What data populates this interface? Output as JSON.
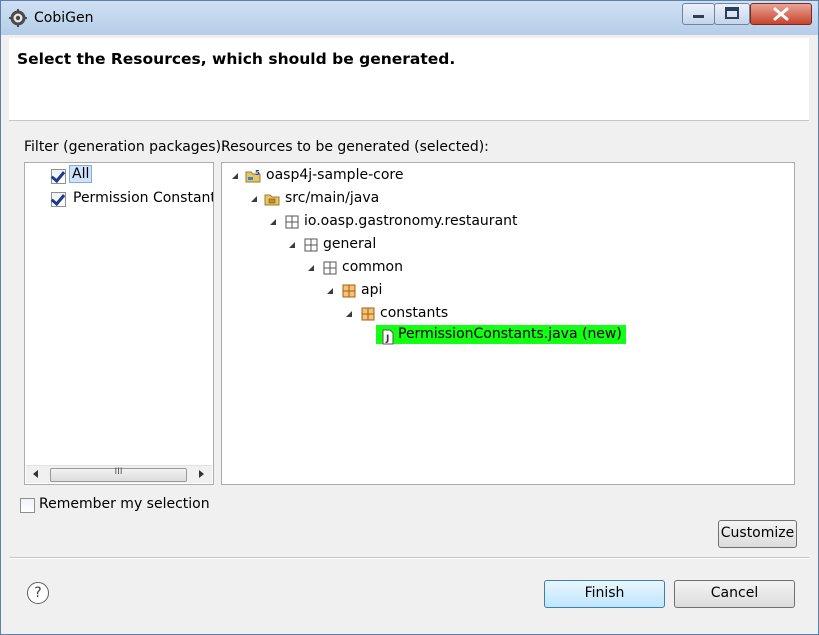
{
  "window": {
    "title": "CobiGen"
  },
  "header": {
    "title": "Select the Resources, which should be generated."
  },
  "filter": {
    "label": "Filter (generation packages):",
    "items": [
      {
        "label": "All",
        "checked": true,
        "selected": true
      },
      {
        "label": "Permission Constants",
        "checked": true,
        "selected": false
      }
    ],
    "scrollbar_grip": "III"
  },
  "resources": {
    "label": "Resources to be generated (selected):",
    "tree": [
      {
        "label": "oasp4j-sample-core",
        "icon": "project-icon"
      },
      {
        "label": "src/main/java",
        "icon": "source-folder-icon"
      },
      {
        "label": "io.oasp.gastronomy.restaurant",
        "icon": "package-icon"
      },
      {
        "label": "general",
        "icon": "package-icon"
      },
      {
        "label": "common",
        "icon": "package-icon"
      },
      {
        "label": "api",
        "icon": "package-icon"
      },
      {
        "label": "constants",
        "icon": "package-icon"
      },
      {
        "label": "PermissionConstants.java (new)",
        "icon": "java-file-icon",
        "highlight_color": "#13ff13"
      }
    ]
  },
  "remember": {
    "label": "Remember my selection",
    "checked": false
  },
  "buttons": {
    "customize": "Customize",
    "finish": "Finish",
    "cancel": "Cancel",
    "help": "?"
  }
}
